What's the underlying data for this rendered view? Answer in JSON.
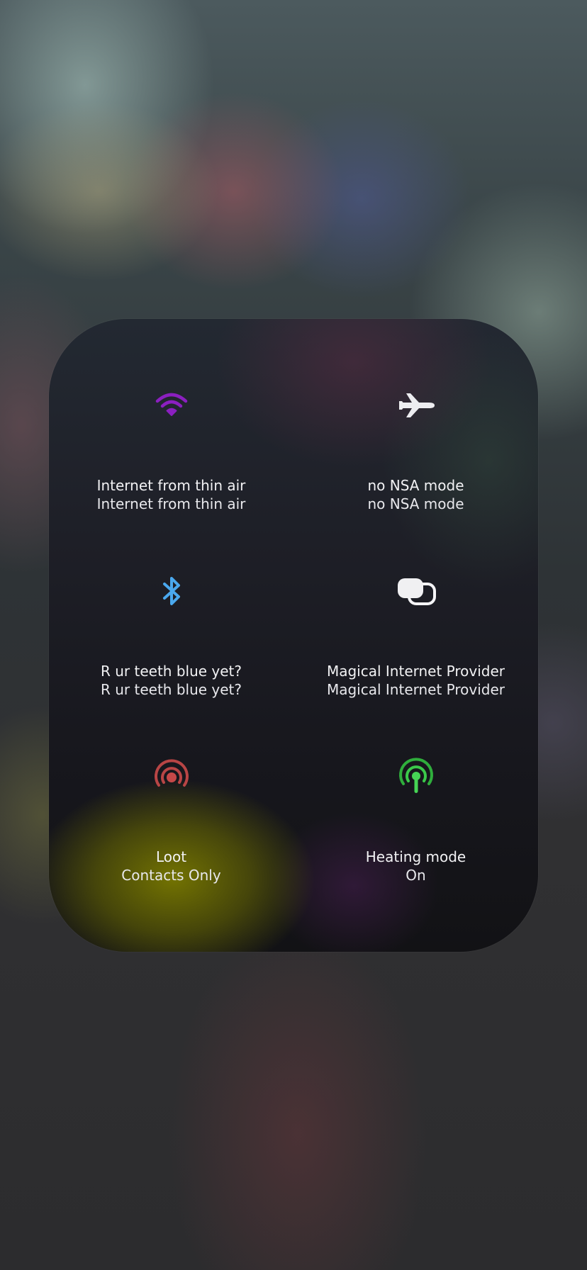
{
  "panel": {
    "tiles": [
      {
        "id": "wifi",
        "icon": "wifi-icon",
        "color": "#8b1fc0",
        "title": "Internet from thin air",
        "subtitle": "Internet from thin air"
      },
      {
        "id": "airplane",
        "icon": "airplane-icon",
        "color": "#e8e8ea",
        "title": "no NSA mode",
        "subtitle": "no NSA mode"
      },
      {
        "id": "bluetooth",
        "icon": "bluetooth-icon",
        "color": "#4aa8ee",
        "title": "R ur teeth blue yet?",
        "subtitle": "R ur teeth blue yet?"
      },
      {
        "id": "cellular",
        "icon": "link-icon",
        "color": "#f2f2f2",
        "title": "Magical Internet Provider",
        "subtitle": "Magical Internet Provider"
      },
      {
        "id": "airdrop",
        "icon": "airdrop-icon",
        "color": "#c04a4a",
        "title": "Loot",
        "subtitle": "Contacts Only"
      },
      {
        "id": "hotspot",
        "icon": "hotspot-icon",
        "color": "#3bc94a",
        "title": "Heating mode",
        "subtitle": "On"
      }
    ]
  }
}
